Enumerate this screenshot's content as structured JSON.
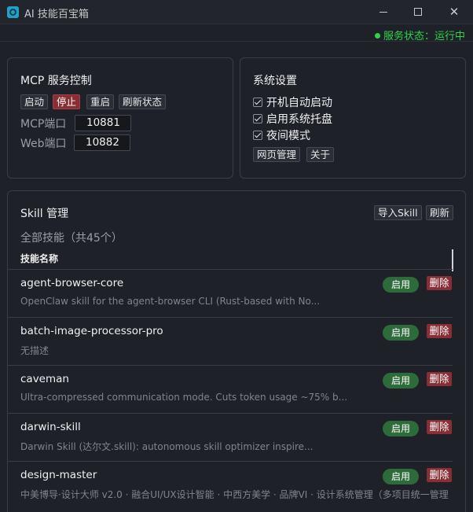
{
  "window": {
    "title": "AI 技能百宝箱",
    "min_icon": "minimize-icon",
    "max_icon": "maximize-icon",
    "close_glyph": "✕"
  },
  "status": {
    "text": "服务状态：运行中",
    "color": "#2bd64a"
  },
  "mcp": {
    "title": "MCP 服务控制",
    "buttons": {
      "start": "启动",
      "stop": "停止",
      "restart": "重启",
      "refresh": "刷新状态"
    },
    "mcp_port_label": "MCP端口",
    "mcp_port_value": "10881",
    "web_port_label": "Web端口",
    "web_port_value": "10882"
  },
  "system": {
    "title": "系统设置",
    "checks": [
      {
        "label": "开机自动启动",
        "checked": true
      },
      {
        "label": "启用系统托盘",
        "checked": true
      },
      {
        "label": "夜间模式",
        "checked": true
      }
    ],
    "buttons": {
      "web_manage": "网页管理",
      "about": "关于"
    }
  },
  "skill": {
    "title": "Skill 管理",
    "import_label": "导入Skill",
    "refresh_label": "刷新",
    "subtitle": "全部技能（共45个）",
    "column_name": "技能名称",
    "enable_label": "启用",
    "delete_label": "删除",
    "items": [
      {
        "name": "agent-browser-core",
        "desc": "OpenClaw skill for the agent-browser CLI (Rust-based with No..."
      },
      {
        "name": "batch-image-processor-pro",
        "desc": "无描述"
      },
      {
        "name": "caveman",
        "desc": "Ultra-compressed communication mode. Cuts token usage ~75% b..."
      },
      {
        "name": "darwin-skill",
        "desc": "Darwin Skill (达尔文.skill): autonomous skill optimizer inspire..."
      },
      {
        "name": "design-master",
        "desc": "中美博导·设计大师 v2.0 · 融合UI/UX设计智能 · 中西方美学 · 品牌VI · 设计系统管理（多项目统一管理"
      }
    ]
  }
}
